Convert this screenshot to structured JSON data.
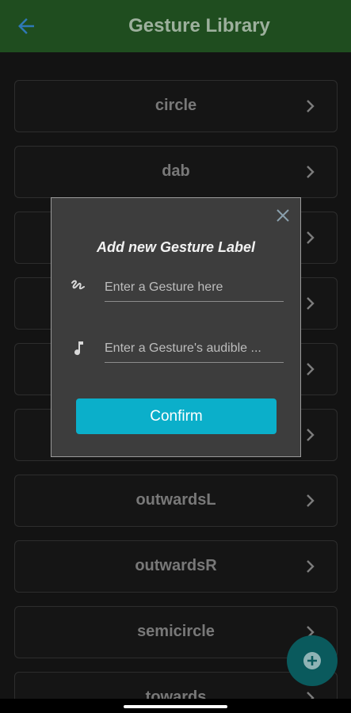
{
  "appbar": {
    "title": "Gesture Library",
    "back_icon": "arrow-left-icon"
  },
  "gestures": [
    {
      "label": "circle"
    },
    {
      "label": "dab"
    },
    {
      "label": ""
    },
    {
      "label": ""
    },
    {
      "label": ""
    },
    {
      "label": ""
    },
    {
      "label": "outwardsL"
    },
    {
      "label": "outwardsR"
    },
    {
      "label": "semicircle"
    },
    {
      "label": "towards"
    }
  ],
  "dialog": {
    "title": "Add new Gesture Label",
    "gesture_field": {
      "placeholder": "Enter a Gesture here",
      "value": "",
      "icon": "gesture-icon"
    },
    "audible_field": {
      "placeholder": "Enter a Gesture's audible ...",
      "value": "",
      "icon": "music-note-icon"
    },
    "confirm_label": "Confirm",
    "close_icon": "close-icon"
  },
  "fab": {
    "icon": "add-circle-icon"
  },
  "colors": {
    "appbar": "#1f4d1f",
    "accent": "#0bafca",
    "fab": "#0a5a5d",
    "background": "#202020"
  }
}
